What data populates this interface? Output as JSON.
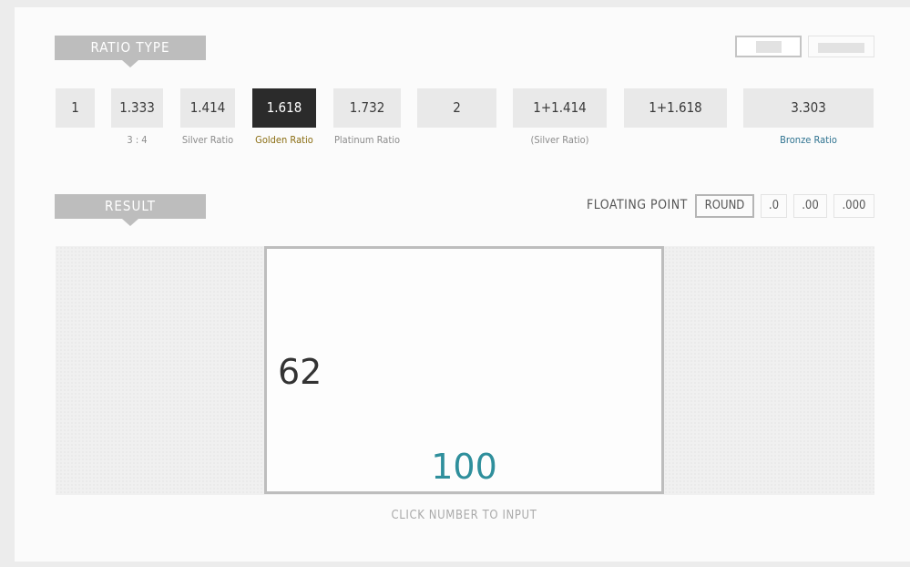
{
  "ratio_section": {
    "title": "RATIO TYPE"
  },
  "view_toggle": {
    "options": [
      "rectangle-view",
      "bar-view"
    ],
    "active": "rectangle-view"
  },
  "ratios": [
    {
      "label": "1",
      "caption": ""
    },
    {
      "label": "1.333",
      "caption": "3 : 4"
    },
    {
      "label": "1.414",
      "caption": "Silver Ratio"
    },
    {
      "label": "1.618",
      "caption": "Golden Ratio",
      "selected": true
    },
    {
      "label": "1.732",
      "caption": "Platinum Ratio"
    },
    {
      "label": "2",
      "caption": ""
    },
    {
      "label": "1+1.414",
      "caption": "(Silver Ratio)"
    },
    {
      "label": "1+1.618",
      "caption": ""
    },
    {
      "label": "3.303",
      "caption": "Bronze Ratio"
    }
  ],
  "result_section": {
    "title": "RESULT",
    "floating_point_label": "FLOATING POINT",
    "precision_options": [
      "ROUND",
      ".0",
      ".00",
      ".000"
    ],
    "active_precision": "ROUND"
  },
  "result": {
    "height_value": "62",
    "width_value": "100",
    "hint": "CLICK NUMBER TO INPUT"
  },
  "colors": {
    "selected_bg": "#2b2b2b",
    "golden_caption": "#8a6d12",
    "bronze_caption": "#2f7390",
    "width_number": "#2f8f9c"
  }
}
